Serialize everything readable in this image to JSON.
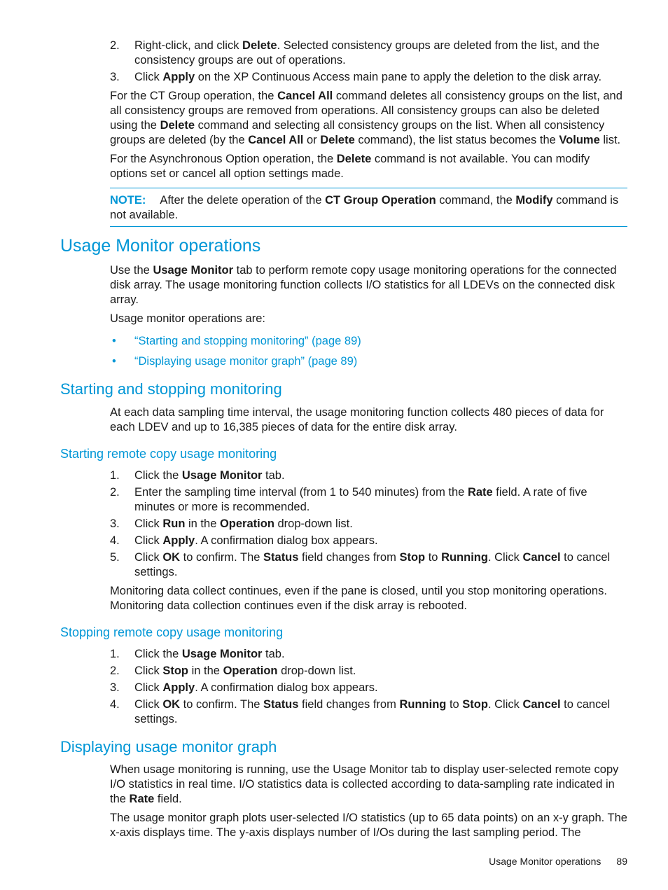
{
  "top_list": [
    {
      "num": "2.",
      "parts": [
        "Right-click, and click ",
        "Delete",
        ". Selected consistency groups are deleted from the list, and the consistency groups are out of operations."
      ]
    },
    {
      "num": "3.",
      "parts": [
        "Click ",
        "Apply",
        " on the XP Continuous Access main pane to apply the deletion to the disk array."
      ]
    }
  ],
  "para_ct_group": [
    "For the CT Group operation, the ",
    "Cancel All",
    " command deletes all consistency groups on the list, and all consistency groups are removed from operations. All consistency groups can also be deleted using the ",
    "Delete",
    " command and selecting all consistency groups on the list. When all consistency groups are deleted (by the ",
    "Cancel All",
    " or ",
    "Delete",
    " command), the list status becomes the ",
    "Volume",
    " list."
  ],
  "para_async": [
    "For the Asynchronous Option operation, the ",
    "Delete",
    " command is not available. You can modify options set or cancel all option settings made."
  ],
  "note": {
    "label": "NOTE:",
    "parts": [
      "After the delete operation of the ",
      "CT Group Operation",
      " command, the ",
      "Modify",
      " command is not available."
    ]
  },
  "section_usage": {
    "title": "Usage Monitor operations",
    "intro": [
      "Use the ",
      "Usage Monitor",
      " tab to perform remote copy usage monitoring operations for the connected disk array. The usage monitoring function collects I/O statistics for all LDEVs on the connected disk array."
    ],
    "ops_intro": "Usage monitor operations are:",
    "links": [
      "“Starting and stopping monitoring” (page 89)",
      "“Displaying usage monitor graph” (page 89)"
    ]
  },
  "section_starting": {
    "title": "Starting and stopping monitoring",
    "para": "At each data sampling time interval, the usage monitoring function collects 480 pieces of data for each LDEV and up to 16,385 pieces of data for the entire disk array."
  },
  "section_start_remote": {
    "title": "Starting remote copy usage monitoring",
    "steps": [
      {
        "num": "1.",
        "parts": [
          "Click the ",
          "Usage Monitor",
          " tab."
        ]
      },
      {
        "num": "2.",
        "parts": [
          "Enter the sampling time interval (from 1 to 540 minutes) from the ",
          "Rate",
          " field. A rate of five minutes or more is recommended."
        ]
      },
      {
        "num": "3.",
        "parts": [
          "Click ",
          "Run",
          " in the ",
          "Operation",
          " drop-down list."
        ]
      },
      {
        "num": "4.",
        "parts": [
          "Click ",
          "Apply",
          ". A confirmation dialog box appears."
        ]
      },
      {
        "num": "5.",
        "parts": [
          "Click ",
          "OK",
          " to confirm. The ",
          "Status",
          " field changes from ",
          "Stop",
          " to ",
          "Running",
          ". Click ",
          "Cancel",
          " to cancel settings."
        ]
      }
    ],
    "after": "Monitoring data collect continues, even if the pane is closed, until you stop monitoring operations. Monitoring data collection continues even if the disk array is rebooted."
  },
  "section_stop_remote": {
    "title": "Stopping remote copy usage monitoring",
    "steps": [
      {
        "num": "1.",
        "parts": [
          "Click the ",
          "Usage Monitor",
          " tab."
        ]
      },
      {
        "num": "2.",
        "parts": [
          "Click ",
          "Stop",
          " in the ",
          "Operation",
          " drop-down list."
        ]
      },
      {
        "num": "3.",
        "parts": [
          "Click ",
          "Apply",
          ". A confirmation dialog box appears."
        ]
      },
      {
        "num": "4.",
        "parts": [
          "Click ",
          "OK",
          " to confirm. The ",
          "Status",
          " field changes from ",
          "Running",
          " to ",
          "Stop",
          ". Click ",
          "Cancel",
          " to cancel settings."
        ]
      }
    ]
  },
  "section_display": {
    "title": "Displaying usage monitor graph",
    "para1": [
      "When usage monitoring is running, use the Usage Monitor tab to display user-selected remote copy I/O statistics in real time. I/O statistics data is collected according to data-sampling rate indicated in the ",
      "Rate",
      " field."
    ],
    "para2": "The usage monitor graph plots user-selected I/O statistics (up to 65 data points) on an x-y graph. The x-axis displays time. The y-axis displays number of I/Os during the last sampling period. The"
  },
  "footer": {
    "section": "Usage Monitor operations",
    "page": "89"
  }
}
